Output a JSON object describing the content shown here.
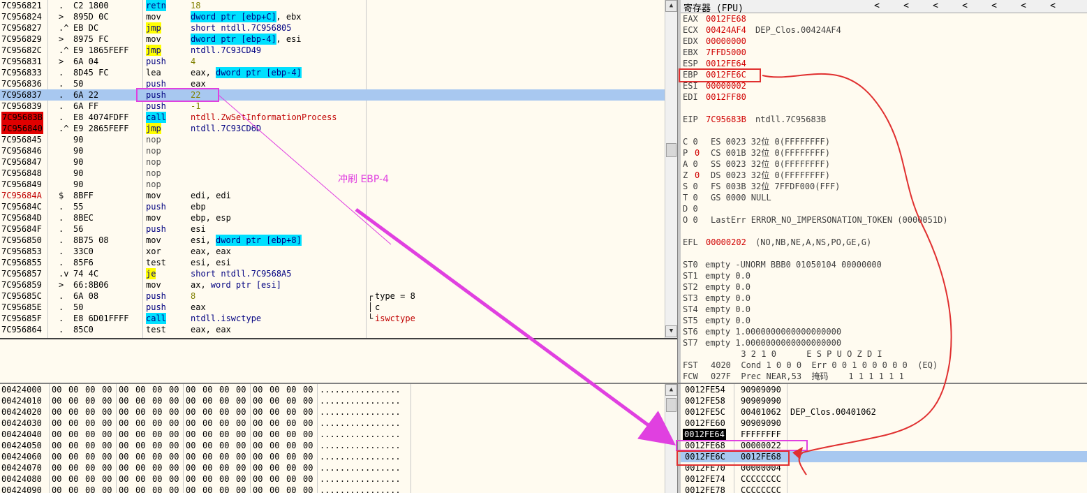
{
  "disasm": {
    "rows": [
      {
        "addr": "7C956821",
        "mk": ".",
        "hex": "C2 1800",
        "op": "retn",
        "opHl": "cyan",
        "args": [
          {
            "t": "18",
            "c": "olive"
          }
        ]
      },
      {
        "addr": "7C956824",
        "mk": ">",
        "hex": "895D 0C",
        "op": "mov",
        "args": [
          {
            "t": "dword ptr [ebp+C]",
            "hl": "cyan",
            "c": "navy"
          },
          {
            "t": ", ebx"
          }
        ]
      },
      {
        "addr": "7C956827",
        "mk": ".^",
        "hex": "EB DC",
        "op": "jmp",
        "opHl": "yellow",
        "args": [
          {
            "t": "short ntdll.7C956805",
            "c": "navy"
          }
        ]
      },
      {
        "addr": "7C956829",
        "mk": ">",
        "hex": "8975 FC",
        "op": "mov",
        "args": [
          {
            "t": "dword ptr [ebp-4]",
            "hl": "cyan",
            "c": "navy"
          },
          {
            "t": ", esi"
          }
        ]
      },
      {
        "addr": "7C95682C",
        "mk": ".^",
        "hex": "E9 1865FEFF",
        "op": "jmp",
        "opHl": "yellow",
        "args": [
          {
            "t": "ntdll.7C93CD49",
            "c": "navy"
          }
        ]
      },
      {
        "addr": "7C956831",
        "mk": ">",
        "hex": "6A 04",
        "op": "push",
        "opC": "navy",
        "args": [
          {
            "t": "4",
            "c": "olive"
          }
        ]
      },
      {
        "addr": "7C956833",
        "mk": ".",
        "hex": "8D45 FC",
        "op": "lea",
        "args": [
          {
            "t": "eax, "
          },
          {
            "t": "dword ptr [ebp-4]",
            "hl": "cyan",
            "c": "navy"
          }
        ]
      },
      {
        "addr": "7C956836",
        "mk": ".",
        "hex": "50",
        "op": "push",
        "opC": "navy",
        "args": [
          {
            "t": "eax"
          }
        ]
      },
      {
        "addr": "7C956837",
        "mk": ".",
        "hex": "6A 22",
        "op": "push",
        "opC": "navy",
        "args": [
          {
            "t": "22",
            "c": "olive"
          }
        ],
        "sel": true
      },
      {
        "addr": "7C956839",
        "mk": ".",
        "hex": "6A FF",
        "op": "push",
        "opC": "navy",
        "args": [
          {
            "t": "-1",
            "c": "olive"
          }
        ]
      },
      {
        "addr": "7C95683B",
        "mk": ".",
        "hex": "E8 4074FDFF",
        "op": "call",
        "opHl": "cyan",
        "args": [
          {
            "t": "ntdll.ZwSetInformationProcess",
            "c": "red"
          }
        ],
        "addrRed": true
      },
      {
        "addr": "7C956840",
        "mk": ".^",
        "hex": "E9 2865FEFF",
        "op": "jmp",
        "opHl": "yellow",
        "args": [
          {
            "t": "ntdll.7C93CD6D",
            "c": "navy"
          }
        ],
        "addrRed": true
      },
      {
        "addr": "7C956845",
        "mk": "",
        "hex": "90",
        "op": "nop",
        "opC": "gray",
        "args": []
      },
      {
        "addr": "7C956846",
        "mk": "",
        "hex": "90",
        "op": "nop",
        "opC": "gray",
        "args": []
      },
      {
        "addr": "7C956847",
        "mk": "",
        "hex": "90",
        "op": "nop",
        "opC": "gray",
        "args": []
      },
      {
        "addr": "7C956848",
        "mk": "",
        "hex": "90",
        "op": "nop",
        "opC": "gray",
        "args": []
      },
      {
        "addr": "7C956849",
        "mk": "",
        "hex": "90",
        "op": "nop",
        "opC": "gray",
        "args": []
      },
      {
        "addr": "7C95684A",
        "mk": "$",
        "hex": "8BFF",
        "op": "mov",
        "args": [
          {
            "t": "edi, edi"
          }
        ],
        "addrC": "red"
      },
      {
        "addr": "7C95684C",
        "mk": ".",
        "hex": "55",
        "op": "push",
        "opC": "navy",
        "args": [
          {
            "t": "ebp"
          }
        ]
      },
      {
        "addr": "7C95684D",
        "mk": ".",
        "hex": "8BEC",
        "op": "mov",
        "args": [
          {
            "t": "ebp, esp"
          }
        ]
      },
      {
        "addr": "7C95684F",
        "mk": ".",
        "hex": "56",
        "op": "push",
        "opC": "navy",
        "args": [
          {
            "t": "esi"
          }
        ]
      },
      {
        "addr": "7C956850",
        "mk": ".",
        "hex": "8B75 08",
        "op": "mov",
        "args": [
          {
            "t": "esi, "
          },
          {
            "t": "dword ptr [ebp+8]",
            "hl": "cyan",
            "c": "navy"
          }
        ]
      },
      {
        "addr": "7C956853",
        "mk": ".",
        "hex": "33C0",
        "op": "xor",
        "args": [
          {
            "t": "eax, eax"
          }
        ]
      },
      {
        "addr": "7C956855",
        "mk": ".",
        "hex": "85F6",
        "op": "test",
        "args": [
          {
            "t": "esi, esi"
          }
        ]
      },
      {
        "addr": "7C956857",
        "mk": ".v",
        "hex": "74 4C",
        "op": "je",
        "opHl": "yellow",
        "args": [
          {
            "t": "short ntdll.7C9568A5",
            "c": "navy"
          }
        ]
      },
      {
        "addr": "7C956859",
        "mk": ">",
        "hex": "66:8B06",
        "op": "mov",
        "args": [
          {
            "t": "ax, "
          },
          {
            "t": "word ptr [esi]",
            "c": "navy"
          }
        ]
      },
      {
        "addr": "7C95685C",
        "mk": ".",
        "hex": "6A 08",
        "op": "push",
        "opC": "navy",
        "args": [
          {
            "t": "8",
            "c": "olive"
          }
        ],
        "cmt": "type = 8",
        "cmtMk": "┌"
      },
      {
        "addr": "7C95685E",
        "mk": ".",
        "hex": "50",
        "op": "push",
        "opC": "navy",
        "args": [
          {
            "t": "eax"
          }
        ],
        "cmt": "c",
        "cmtMk": "│"
      },
      {
        "addr": "7C95685F",
        "mk": ".",
        "hex": "E8 6D01FFFF",
        "op": "call",
        "opHl": "cyan",
        "args": [
          {
            "t": "ntdll.iswctype",
            "c": "navy"
          }
        ],
        "cmt": "iswctype",
        "cmtMk": "└",
        "cmtC": "red"
      },
      {
        "addr": "7C956864",
        "mk": ".",
        "hex": "85C0",
        "op": "test",
        "args": [
          {
            "t": "eax, eax"
          }
        ]
      }
    ]
  },
  "registers": {
    "title": "寄存器 (FPU)",
    "lines": [
      {
        "l": "EAX",
        "v": "0012FE68",
        "vc": "red",
        "e": ""
      },
      {
        "l": "ECX",
        "v": "00424AF4",
        "vc": "red",
        "e": "DEP_Clos.00424AF4"
      },
      {
        "l": "EDX",
        "v": "00000000",
        "vc": "red",
        "e": ""
      },
      {
        "l": "EBX",
        "v": "7FFD5000",
        "vc": "red",
        "e": ""
      },
      {
        "l": "ESP",
        "v": "0012FE64",
        "vc": "red",
        "e": ""
      },
      {
        "l": "EBP",
        "v": "0012FE6C",
        "vc": "red",
        "e": ""
      },
      {
        "l": "ESI",
        "v": "00000002",
        "vc": "red",
        "e": ""
      },
      {
        "l": "EDI",
        "v": "0012FF80",
        "vc": "red",
        "e": ""
      },
      {
        "l": "",
        "v": "",
        "e": ""
      },
      {
        "l": "EIP",
        "v": "7C95683B",
        "vc": "red",
        "e": "ntdll.7C95683B"
      },
      {
        "l": "",
        "v": "",
        "e": ""
      },
      {
        "l": "C 0",
        "v": "",
        "e": "ES 0023 32位 0(FFFFFFFF)"
      },
      {
        "l": "P",
        "flag": "0",
        "e": "CS 001B 32位 0(FFFFFFFF)"
      },
      {
        "l": "A 0",
        "v": "",
        "e": "SS 0023 32位 0(FFFFFFFF)"
      },
      {
        "l": "Z",
        "flag": "0",
        "e": "DS 0023 32位 0(FFFFFFFF)"
      },
      {
        "l": "S 0",
        "v": "",
        "e": "FS 003B 32位 7FFDF000(FFF)"
      },
      {
        "l": "T 0",
        "v": "",
        "e": "GS 0000 NULL"
      },
      {
        "l": "D 0",
        "v": "",
        "e": ""
      },
      {
        "l": "O 0",
        "v": "",
        "e": "LastErr ERROR_NO_IMPERSONATION_TOKEN (0000051D)"
      },
      {
        "l": "",
        "v": "",
        "e": ""
      },
      {
        "l": "EFL",
        "v": "00000202",
        "vc": "red",
        "e": "(NO,NB,NE,A,NS,PO,GE,G)"
      },
      {
        "l": "",
        "v": "",
        "e": ""
      },
      {
        "l": "ST0",
        "v": "",
        "e": "empty -UNORM BBB0 01050104 00000000"
      },
      {
        "l": "ST1",
        "v": "",
        "e": "empty 0.0"
      },
      {
        "l": "ST2",
        "v": "",
        "e": "empty 0.0"
      },
      {
        "l": "ST3",
        "v": "",
        "e": "empty 0.0"
      },
      {
        "l": "ST4",
        "v": "",
        "e": "empty 0.0"
      },
      {
        "l": "ST5",
        "v": "",
        "e": "empty 0.0"
      },
      {
        "l": "ST6",
        "v": "",
        "e": "empty 1.0000000000000000000"
      },
      {
        "l": "ST7",
        "v": "",
        "e": "empty 1.0000000000000000000"
      },
      {
        "l": "",
        "v": "",
        "e": "      3 2 1 0      E S P U O Z D I"
      },
      {
        "l": "FST",
        "v": "",
        "e": "4020  Cond 1 0 0 0  Err 0 0 1 0 0 0 0 0  (EQ)"
      },
      {
        "l": "FCW",
        "v": "",
        "e": "027F  Prec NEAR,53  掩码    1 1 1 1 1 1"
      }
    ]
  },
  "dump": {
    "rows": [
      {
        "a": "00424000",
        "h": [
          "00",
          "00",
          "00",
          "00",
          "00",
          "00",
          "00",
          "00",
          "00",
          "00",
          "00",
          "00",
          "00",
          "00",
          "00",
          "00"
        ],
        "s": "................"
      },
      {
        "a": "00424010",
        "h": [
          "00",
          "00",
          "00",
          "00",
          "00",
          "00",
          "00",
          "00",
          "00",
          "00",
          "00",
          "00",
          "00",
          "00",
          "00",
          "00"
        ],
        "s": "................"
      },
      {
        "a": "00424020",
        "h": [
          "00",
          "00",
          "00",
          "00",
          "00",
          "00",
          "00",
          "00",
          "00",
          "00",
          "00",
          "00",
          "00",
          "00",
          "00",
          "00"
        ],
        "s": "................"
      },
      {
        "a": "00424030",
        "h": [
          "00",
          "00",
          "00",
          "00",
          "00",
          "00",
          "00",
          "00",
          "00",
          "00",
          "00",
          "00",
          "00",
          "00",
          "00",
          "00"
        ],
        "s": "................"
      },
      {
        "a": "00424040",
        "h": [
          "00",
          "00",
          "00",
          "00",
          "00",
          "00",
          "00",
          "00",
          "00",
          "00",
          "00",
          "00",
          "00",
          "00",
          "00",
          "00"
        ],
        "s": "................"
      },
      {
        "a": "00424050",
        "h": [
          "00",
          "00",
          "00",
          "00",
          "00",
          "00",
          "00",
          "00",
          "00",
          "00",
          "00",
          "00",
          "00",
          "00",
          "00",
          "00"
        ],
        "s": "................"
      },
      {
        "a": "00424060",
        "h": [
          "00",
          "00",
          "00",
          "00",
          "00",
          "00",
          "00",
          "00",
          "00",
          "00",
          "00",
          "00",
          "00",
          "00",
          "00",
          "00"
        ],
        "s": "................"
      },
      {
        "a": "00424070",
        "h": [
          "00",
          "00",
          "00",
          "00",
          "00",
          "00",
          "00",
          "00",
          "00",
          "00",
          "00",
          "00",
          "00",
          "00",
          "00",
          "00"
        ],
        "s": "................"
      },
      {
        "a": "00424080",
        "h": [
          "00",
          "00",
          "00",
          "00",
          "00",
          "00",
          "00",
          "00",
          "00",
          "00",
          "00",
          "00",
          "00",
          "00",
          "00",
          "00"
        ],
        "s": "................"
      },
      {
        "a": "00424090",
        "h": [
          "00",
          "00",
          "00",
          "00",
          "00",
          "00",
          "00",
          "00",
          "00",
          "00",
          "00",
          "00",
          "00",
          "00",
          "00",
          "00"
        ],
        "s": "................"
      }
    ]
  },
  "stack": {
    "rows": [
      {
        "a": "0012FE54",
        "v": "90909090",
        "c": ""
      },
      {
        "a": "0012FE58",
        "v": "90909090",
        "c": ""
      },
      {
        "a": "0012FE5C",
        "v": "00401062",
        "c": "DEP_Clos.00401062"
      },
      {
        "a": "0012FE60",
        "v": "90909090",
        "c": ""
      },
      {
        "a": "0012FE64",
        "v": "FFFFFFFF",
        "c": "",
        "top": true
      },
      {
        "a": "0012FE68",
        "v": "00000022",
        "c": ""
      },
      {
        "a": "0012FE6C",
        "v": "0012FE68",
        "c": "",
        "sel": true
      },
      {
        "a": "0012FE70",
        "v": "00000004",
        "c": ""
      },
      {
        "a": "0012FE74",
        "v": "CCCCCCCC",
        "c": ""
      },
      {
        "a": "0012FE78",
        "v": "CCCCCCCC",
        "c": ""
      }
    ]
  },
  "annotation": {
    "text": "冲刷 EBP-4",
    "color": "#e040e0"
  }
}
